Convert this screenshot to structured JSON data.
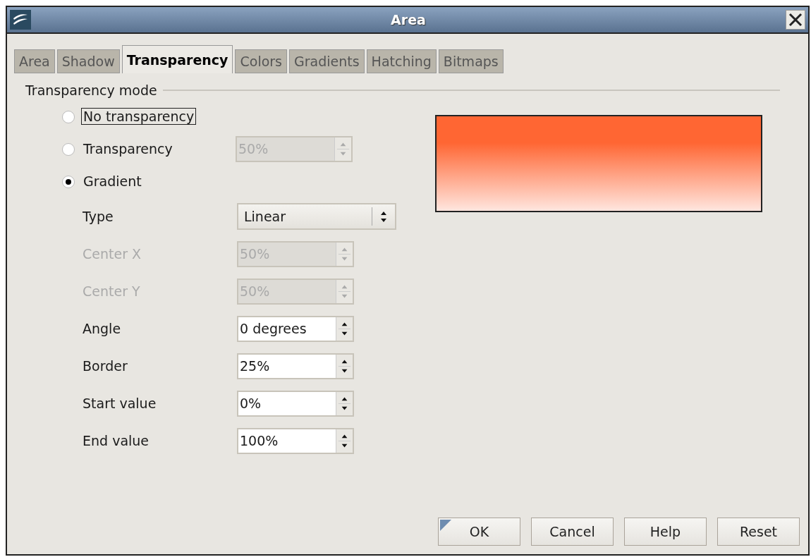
{
  "window": {
    "title": "Area"
  },
  "tabs": [
    {
      "label": "Area",
      "selected": false
    },
    {
      "label": "Shadow",
      "selected": false
    },
    {
      "label": "Transparency",
      "selected": true
    },
    {
      "label": "Colors",
      "selected": false
    },
    {
      "label": "Gradients",
      "selected": false
    },
    {
      "label": "Hatching",
      "selected": false
    },
    {
      "label": "Bitmaps",
      "selected": false
    }
  ],
  "section_title": "Transparency mode",
  "mode_options": [
    {
      "label": "No transparency",
      "selected": false,
      "focused": true
    },
    {
      "label": "Transparency",
      "selected": false,
      "focused": false,
      "field": {
        "value": "50%",
        "disabled": true
      }
    },
    {
      "label": "Gradient",
      "selected": true,
      "focused": false
    }
  ],
  "gradient_settings": [
    {
      "kind": "select",
      "label": "Type",
      "value": "Linear",
      "disabled": false
    },
    {
      "kind": "spin",
      "label": "Center X",
      "value": "50%",
      "disabled": true
    },
    {
      "kind": "spin",
      "label": "Center Y",
      "value": "50%",
      "disabled": true
    },
    {
      "kind": "spin",
      "label": "Angle",
      "value": "0 degrees",
      "disabled": false
    },
    {
      "kind": "spin",
      "label": "Border",
      "value": "25%",
      "disabled": false
    },
    {
      "kind": "spin",
      "label": "Start value",
      "value": "0%",
      "disabled": false
    },
    {
      "kind": "spin",
      "label": "End value",
      "value": "100%",
      "disabled": false
    }
  ],
  "buttons": [
    {
      "label": "OK",
      "default": true
    },
    {
      "label": "Cancel",
      "default": false
    },
    {
      "label": "Help",
      "default": false
    },
    {
      "label": "Reset",
      "default": false
    }
  ]
}
